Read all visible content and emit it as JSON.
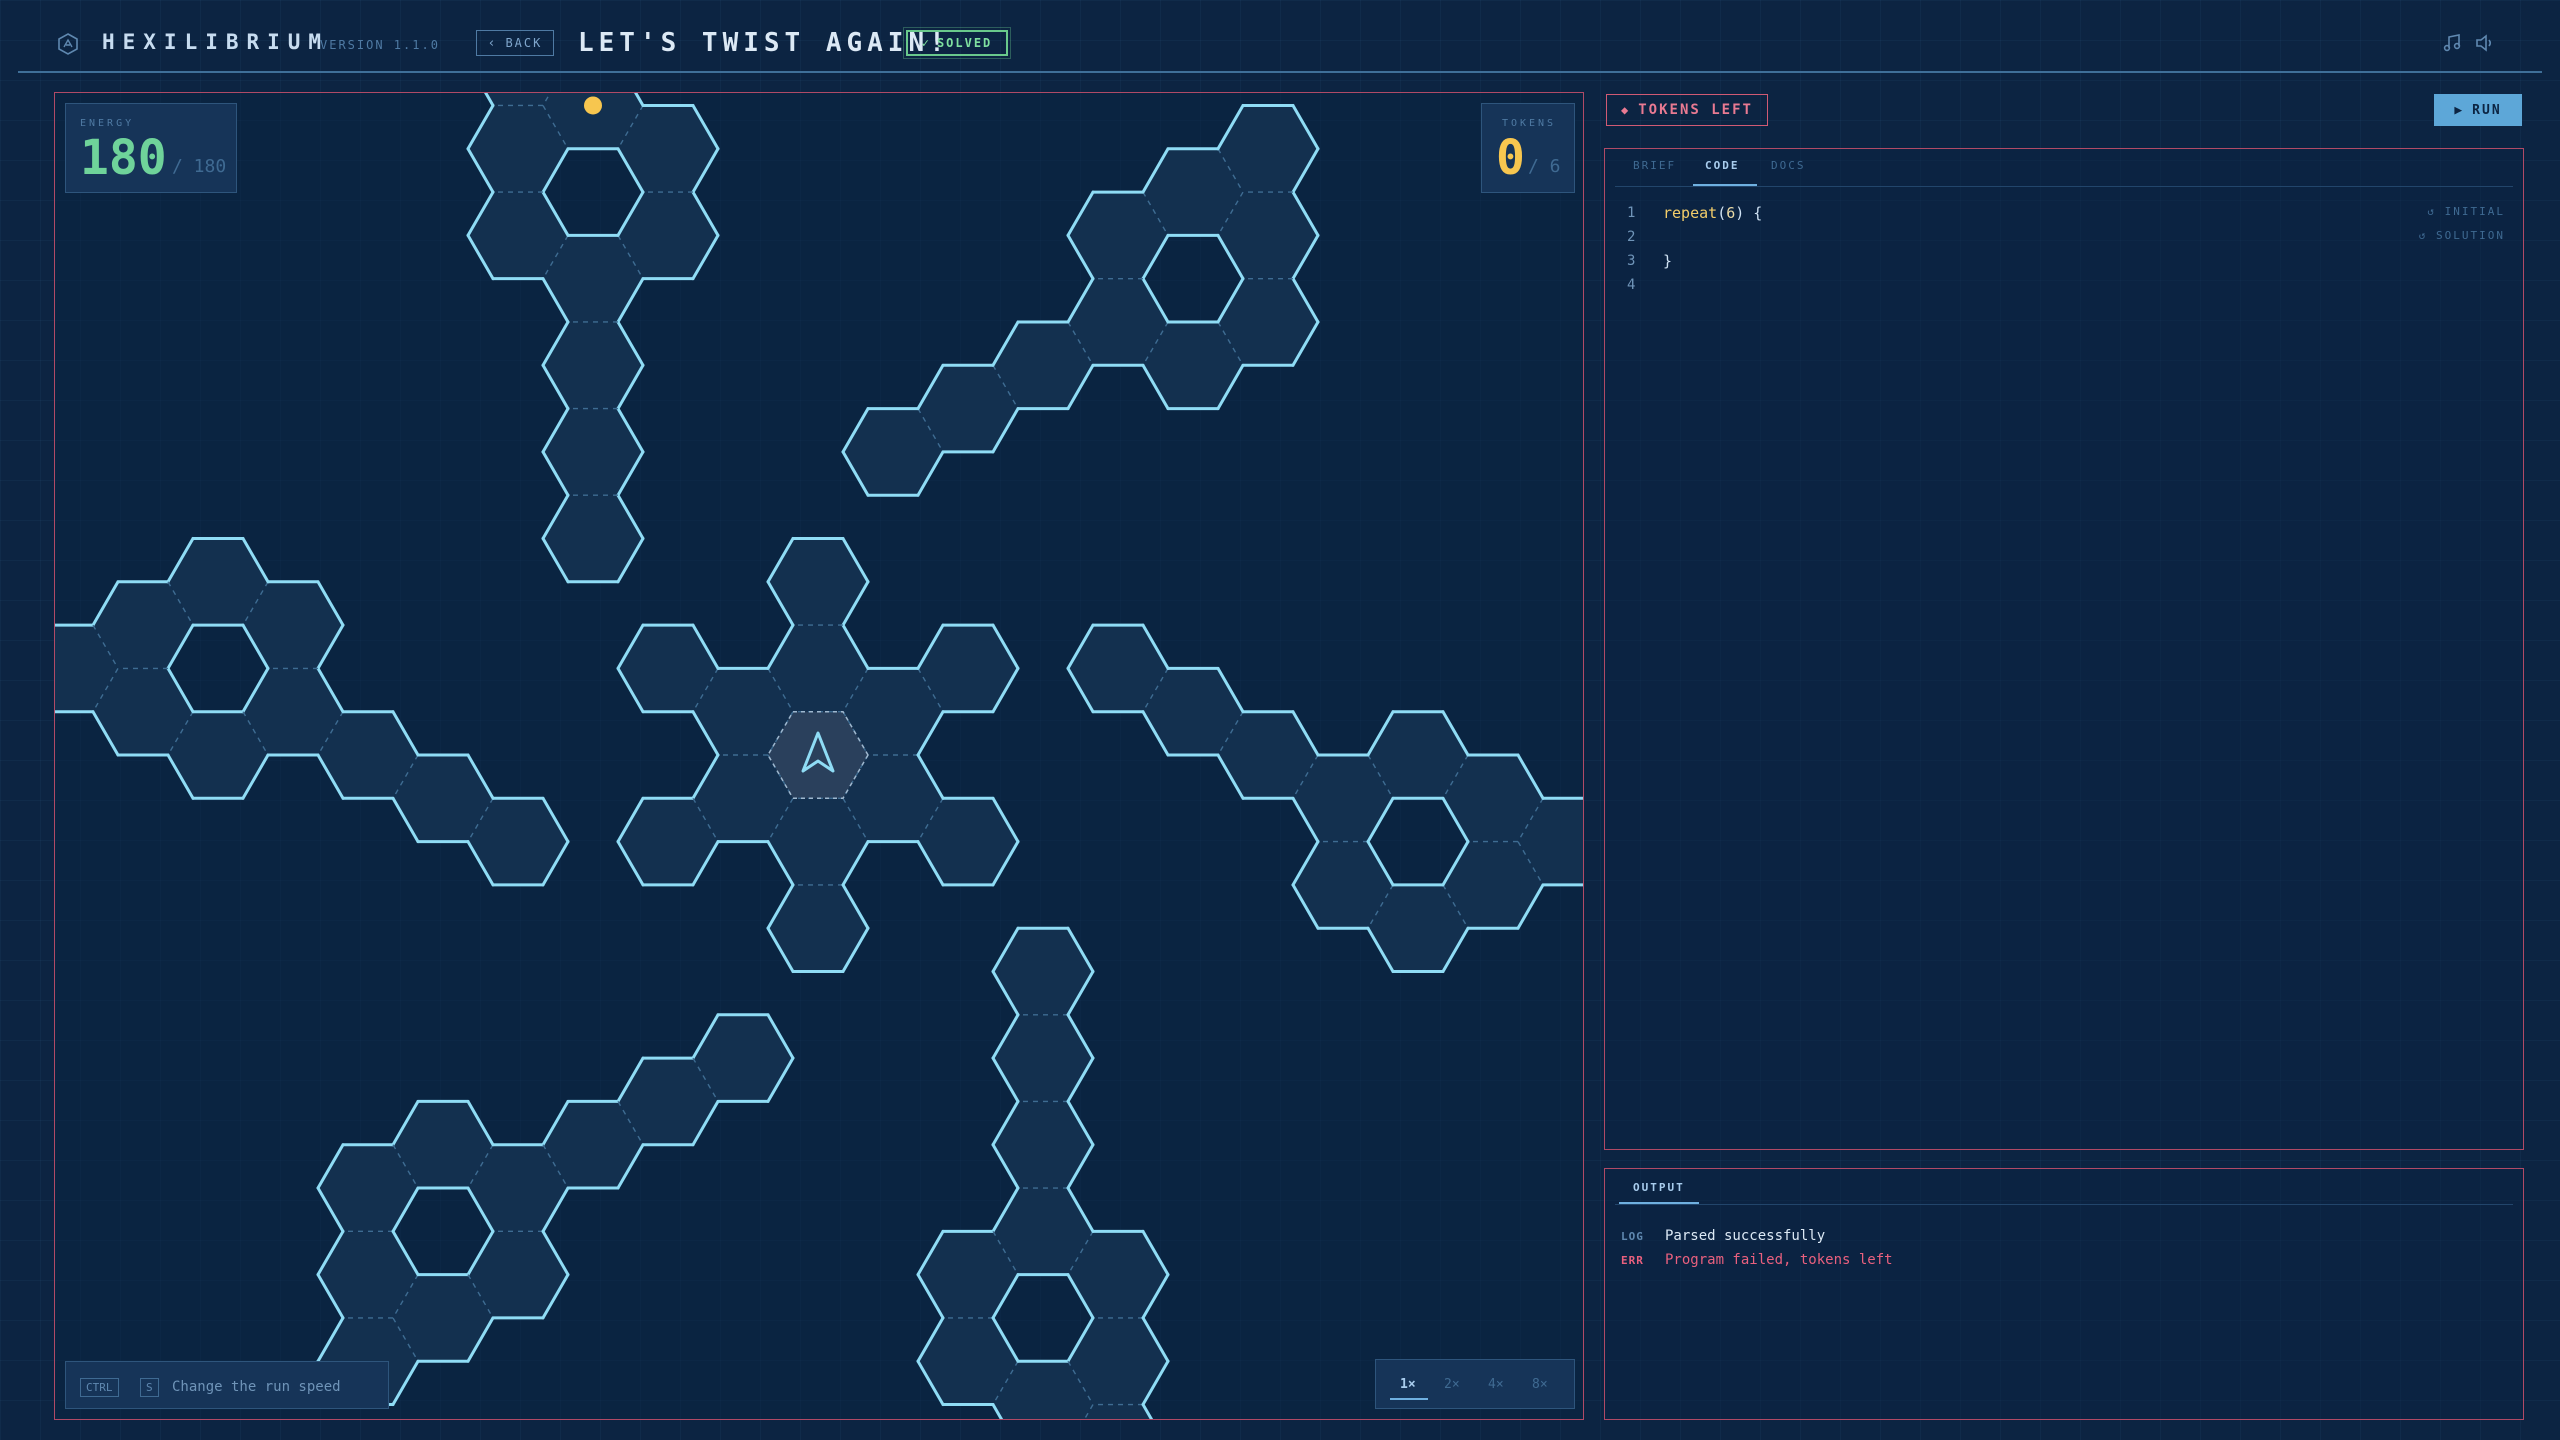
{
  "header": {
    "app_title": "HEXILIBRIUM",
    "version": "VERSION 1.1.0",
    "back_label": "BACK",
    "level_title": "LET'S TWIST AGAIN!",
    "solved_label": "SOLVED"
  },
  "board": {
    "energy_label": "ENERGY",
    "energy_value": "180",
    "energy_max": "/ 180",
    "tokens_label": "TOKENS",
    "tokens_value": "0",
    "tokens_max": "/ 6",
    "hint_key_1": "CTRL",
    "hint_key_2": "S",
    "hint_text": "Change the run speed",
    "speeds": [
      "1×",
      "2×",
      "4×",
      "8×"
    ],
    "selected_speed": "1×"
  },
  "status": {
    "tokens_left_label": "TOKENS LEFT"
  },
  "run_label": "RUN",
  "editor": {
    "tabs": [
      "BRIEF",
      "CODE",
      "DOCS"
    ],
    "active_tab": "CODE",
    "initial_label": "INITIAL",
    "solution_label": "SOLUTION",
    "lines": [
      {
        "n": "1",
        "kw": "repeat",
        "open": "(",
        "arg": "6",
        "rest": ") {"
      },
      {
        "n": "2",
        "text": ""
      },
      {
        "n": "3",
        "text": "}"
      },
      {
        "n": "4",
        "text": ""
      }
    ]
  },
  "output": {
    "tab_label": "OUTPUT",
    "entries": [
      {
        "tag": "LOG",
        "message": "Parsed successfully",
        "color": "#dce9f5",
        "tag_color": "#5f88b0"
      },
      {
        "tag": "ERR",
        "message": "Program failed, tokens left",
        "color": "#e9607e",
        "tag_color": "#e9607e"
      }
    ]
  },
  "colors": {
    "hex_stroke": "#8fdcf5",
    "hex_fill": "#13304f",
    "token": "#f7c64f",
    "accent_green": "#6fd39a",
    "error": "#e9607e"
  }
}
